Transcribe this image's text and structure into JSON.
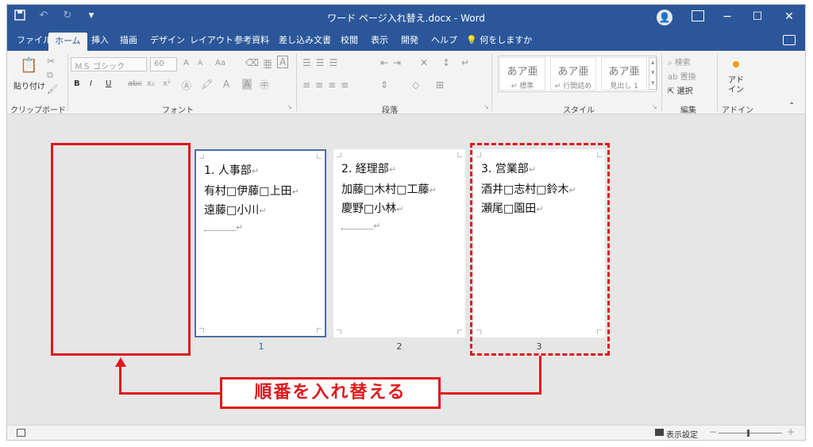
{
  "app": {
    "title": "ワード ページ入れ替え.docx - Word",
    "accent_color": "#2b579a",
    "annotation_color": "#e0171b"
  },
  "qat": {
    "autosave_icon": "save-icon",
    "undo_icon": "undo-icon",
    "redo_icon": "redo-icon",
    "more_icon": "chevron-down-icon"
  },
  "window": {
    "minimize": "−",
    "restore": "☐",
    "close": "✕"
  },
  "tabs": [
    "ファイル",
    "ホーム",
    "挿入",
    "描画",
    "デザイン",
    "レイアウト",
    "参考資料",
    "差し込み文書",
    "校閲",
    "表示",
    "開発",
    "ヘルプ",
    "何をしますか"
  ],
  "ribbon": {
    "clipboard": {
      "paste": "貼り付け",
      "label": "クリップボード"
    },
    "font": {
      "font_name": "ＭＳ ゴシック",
      "font_size": "60",
      "label": "フォント",
      "bold": "B",
      "italic": "I",
      "underline": "U",
      "strike": "abc",
      "sub": "x₂",
      "sup": "x²",
      "grow": "A",
      "shrink": "A",
      "case": "Aa"
    },
    "paragraph": {
      "label": "段落"
    },
    "styles": {
      "label": "スタイル",
      "items": [
        {
          "sample": "あア亜",
          "name": "↵ 標準"
        },
        {
          "sample": "あア亜",
          "name": "↵ 行間詰め"
        },
        {
          "sample": "あア亜",
          "name": "見出し 1"
        }
      ]
    },
    "editing": {
      "find": "検索",
      "replace": "置換",
      "select": "選択",
      "label": "編集"
    },
    "addins": {
      "button": "アド\nイン",
      "label": "アドイン"
    }
  },
  "pages": [
    {
      "number": "1",
      "lines": [
        "1. 人事部",
        "有村□伊藤□上田",
        "遠藤□小川"
      ]
    },
    {
      "number": "2",
      "lines": [
        "2. 経理部",
        "加藤□木村□工藤",
        "慶野□小林"
      ]
    },
    {
      "number": "3",
      "lines": [
        "3. 営業部",
        "酒井□志村□鈴木",
        "瀬尾□園田"
      ]
    }
  ],
  "annotation": {
    "callout": "順番を入れ替える"
  },
  "status": {
    "display_settings": "表示設定",
    "zoom_minus": "−",
    "zoom_plus": "+"
  }
}
